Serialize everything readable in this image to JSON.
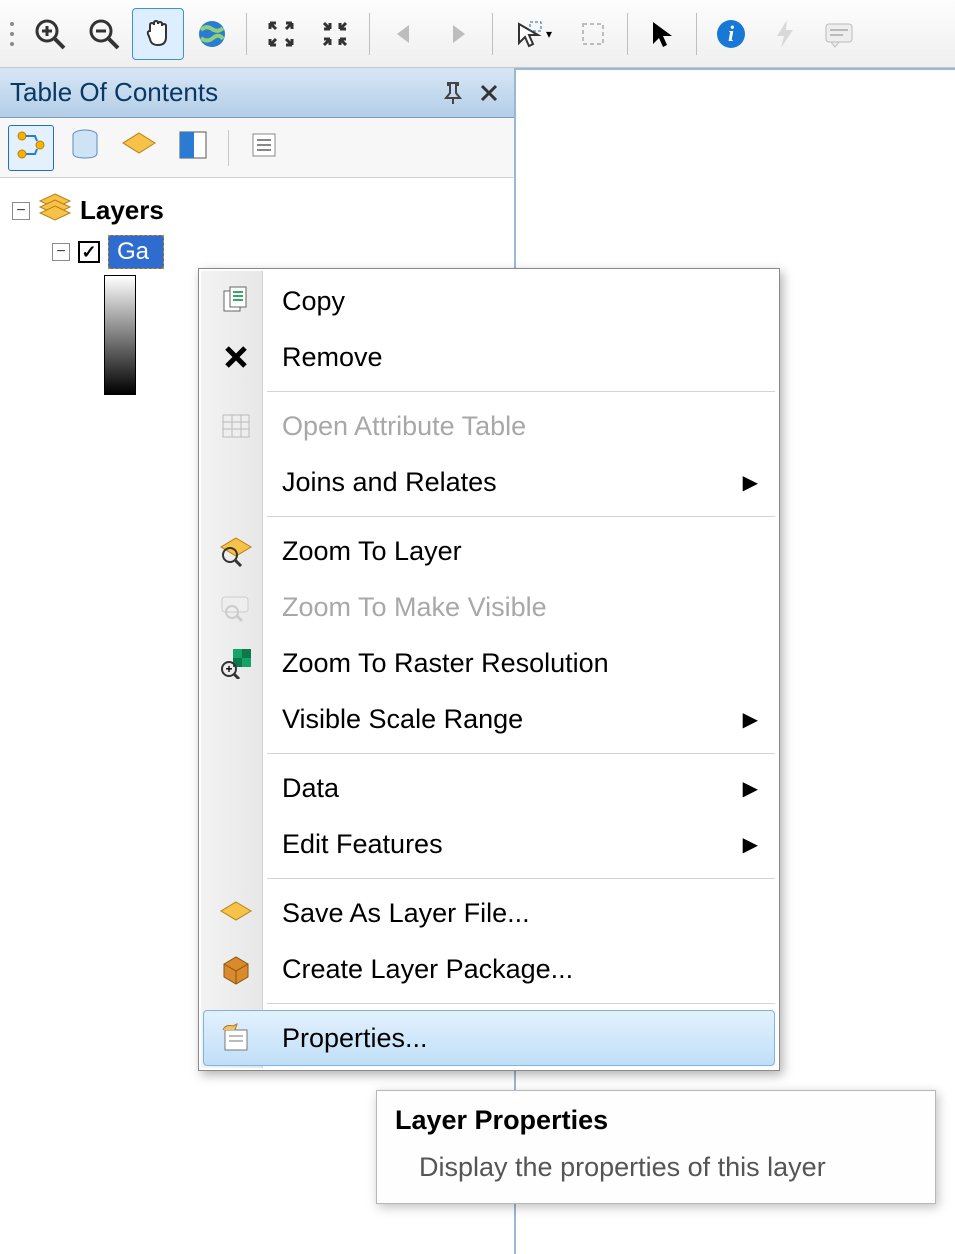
{
  "toolbar": {
    "buttons": [
      {
        "icon": "zoom-in-icon",
        "name": "zoom-in-button",
        "interactable": true
      },
      {
        "icon": "zoom-out-icon",
        "name": "zoom-out-button",
        "interactable": true
      },
      {
        "icon": "pan-icon",
        "name": "pan-button",
        "interactable": true,
        "active": true
      },
      {
        "icon": "globe-icon",
        "name": "full-extent-button",
        "interactable": true
      },
      "sep",
      {
        "icon": "fixed-zoom-in-icon",
        "name": "fixed-zoom-in-button",
        "interactable": true
      },
      {
        "icon": "fixed-zoom-out-icon",
        "name": "fixed-zoom-out-button",
        "interactable": true
      },
      "sep",
      {
        "icon": "back-icon",
        "name": "previous-extent-button",
        "interactable": false
      },
      {
        "icon": "forward-icon",
        "name": "next-extent-button",
        "interactable": false
      },
      "sep",
      {
        "icon": "select-features-icon",
        "name": "select-features-button",
        "interactable": true,
        "dropdown": true
      },
      {
        "icon": "clear-selection-icon",
        "name": "clear-selection-button",
        "interactable": false
      },
      "sep",
      {
        "icon": "select-elements-icon",
        "name": "select-elements-button",
        "interactable": true
      },
      "sep",
      {
        "icon": "identify-icon",
        "name": "identify-button",
        "interactable": true
      },
      {
        "icon": "lightning-icon",
        "name": "html-popup-button",
        "interactable": false
      },
      {
        "icon": "stickynote-icon",
        "name": "measure-button",
        "interactable": false
      }
    ]
  },
  "toc": {
    "title": "Table Of Contents",
    "toolbar": [
      {
        "icon": "list-by-drawing-order-icon",
        "name": "list-by-drawing-order-button",
        "active": true
      },
      {
        "icon": "list-by-source-icon",
        "name": "list-by-source-button"
      },
      {
        "icon": "list-by-visibility-icon",
        "name": "list-by-visibility-button"
      },
      {
        "icon": "list-by-selection-icon",
        "name": "list-by-selection-button"
      },
      "sep",
      {
        "icon": "options-icon",
        "name": "toc-options-button"
      }
    ],
    "root_label": "Layers",
    "selected_layer_label": "Ga"
  },
  "context_menu": {
    "items": [
      {
        "label": "Copy",
        "icon": "copy-icon",
        "name": "ctx-copy"
      },
      {
        "label": "Remove",
        "icon": "remove-icon",
        "name": "ctx-remove"
      },
      "sep",
      {
        "label": "Open Attribute Table",
        "icon": "table-icon",
        "name": "ctx-open-attr-table",
        "disabled": true
      },
      {
        "label": "Joins and Relates",
        "icon": "",
        "name": "ctx-joins-relates",
        "submenu": true
      },
      "sep",
      {
        "label": "Zoom To Layer",
        "icon": "zoom-layer-icon",
        "name": "ctx-zoom-to-layer"
      },
      {
        "label": "Zoom To Make Visible",
        "icon": "zoom-vis-icon",
        "name": "ctx-zoom-make-visible",
        "disabled": true
      },
      {
        "label": "Zoom To Raster Resolution",
        "icon": "zoom-raster-icon",
        "name": "ctx-zoom-raster"
      },
      {
        "label": "Visible Scale Range",
        "icon": "",
        "name": "ctx-visible-scale",
        "submenu": true
      },
      "sep",
      {
        "label": "Data",
        "icon": "",
        "name": "ctx-data",
        "submenu": true
      },
      {
        "label": "Edit Features",
        "icon": "",
        "name": "ctx-edit-features",
        "submenu": true
      },
      "sep",
      {
        "label": "Save As Layer File...",
        "icon": "save-layer-icon",
        "name": "ctx-save-layer-file"
      },
      {
        "label": "Create Layer Package...",
        "icon": "package-icon",
        "name": "ctx-create-layer-package"
      },
      "sep",
      {
        "label": "Properties...",
        "icon": "properties-icon",
        "name": "ctx-properties",
        "hovered": true
      }
    ]
  },
  "tooltip": {
    "title": "Layer Properties",
    "body": "Display the properties of this layer"
  }
}
